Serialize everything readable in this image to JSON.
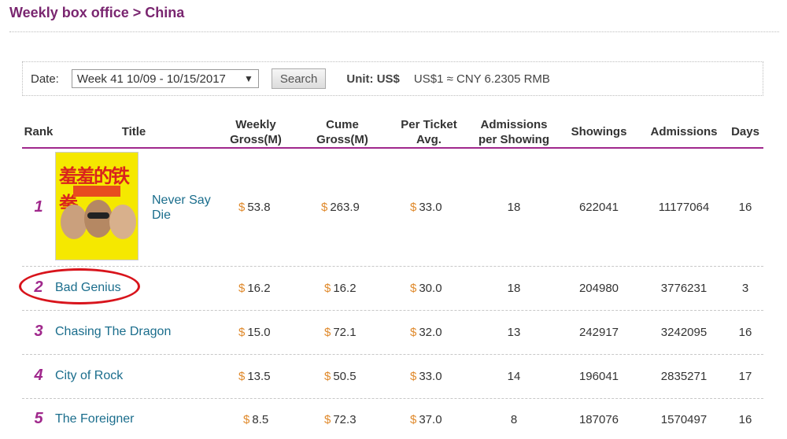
{
  "header": {
    "title": "Weekly box office > China"
  },
  "filter": {
    "date_label": "Date:",
    "date_value": "Week 41 10/09 - 10/15/2017",
    "search_label": "Search",
    "unit_label": "Unit: US$",
    "rate_text": "US$1 ≈ CNY 6.2305 RMB"
  },
  "columns": {
    "rank": "Rank",
    "title": "Title",
    "weekly_1": "Weekly",
    "weekly_2": "Gross(M)",
    "cume_1": "Cume",
    "cume_2": "Gross(M)",
    "ticket_1": "Per Ticket",
    "ticket_2": "Avg.",
    "adm_show_1": "Admissions",
    "adm_show_2": "per Showing",
    "showings": "Showings",
    "admissions": "Admissions",
    "days": "Days"
  },
  "currency_symbol": "$",
  "poster": {
    "title_text": "羞羞的铁拳"
  },
  "rows": [
    {
      "rank": "1",
      "title_1": "Never Say",
      "title_2": "Die",
      "weekly": "53.8",
      "cume": "263.9",
      "ticket": "33.0",
      "adm_per_show": "18",
      "showings": "622041",
      "admissions": "11177064",
      "days": "16"
    },
    {
      "rank": "2",
      "title": "Bad Genius",
      "weekly": "16.2",
      "cume": "16.2",
      "ticket": "30.0",
      "adm_per_show": "18",
      "showings": "204980",
      "admissions": "3776231",
      "days": "3"
    },
    {
      "rank": "3",
      "title": "Chasing The Dragon",
      "weekly": "15.0",
      "cume": "72.1",
      "ticket": "32.0",
      "adm_per_show": "13",
      "showings": "242917",
      "admissions": "3242095",
      "days": "16"
    },
    {
      "rank": "4",
      "title": "City of Rock",
      "weekly": "13.5",
      "cume": "50.5",
      "ticket": "33.0",
      "adm_per_show": "14",
      "showings": "196041",
      "admissions": "2835271",
      "days": "17"
    },
    {
      "rank": "5",
      "title": "The Foreigner",
      "weekly": "8.5",
      "cume": "72.3",
      "ticket": "37.0",
      "adm_per_show": "8",
      "showings": "187076",
      "admissions": "1570497",
      "days": "16"
    }
  ],
  "colors": {
    "brand": "#7a2670",
    "accent": "#a0288c",
    "link": "#1a6d8c",
    "currency": "#e08a2c",
    "highlight": "#d8141c"
  }
}
